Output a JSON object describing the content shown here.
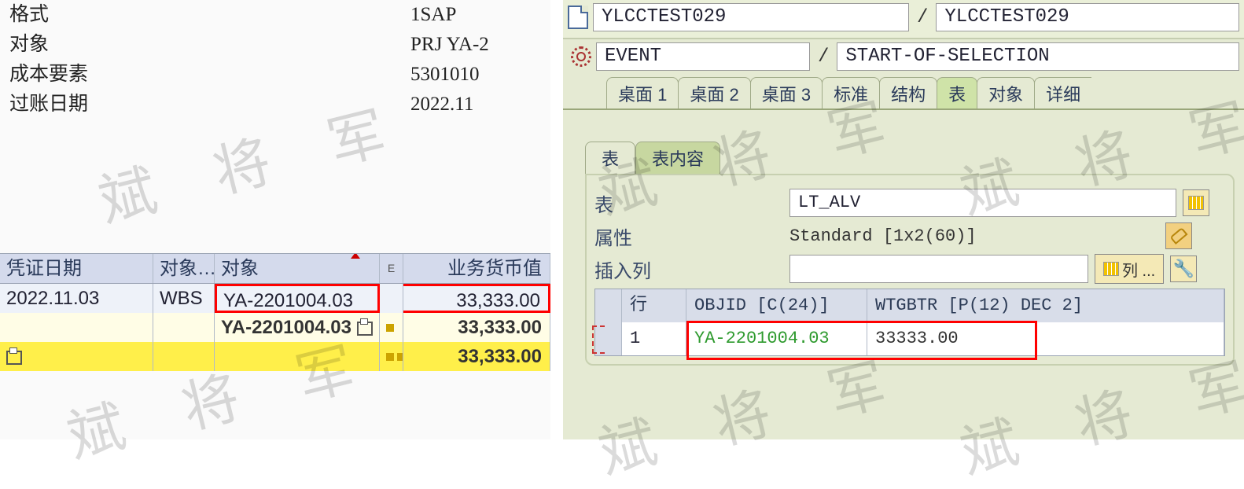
{
  "left": {
    "fields": [
      {
        "label": "格式",
        "value": "1SAP"
      },
      {
        "label": "对象",
        "value": "PRJ YA-2"
      },
      {
        "label": "成本要素",
        "value": "5301010"
      },
      {
        "label": "过账日期",
        "value": "2022.11"
      }
    ],
    "table": {
      "columns": [
        "凭证日期",
        "对象…",
        "对象",
        "E",
        "业务货币值"
      ],
      "rows": [
        {
          "date": "2022.11.03",
          "type": "WBS",
          "obj": "YA-2201004.03",
          "e": "",
          "val": "33,333.00",
          "kind": "data"
        },
        {
          "date": "",
          "type": "",
          "obj": "YA-2201004.03",
          "e": "▪",
          "val": "33,333.00",
          "kind": "sub",
          "icon": true
        },
        {
          "date": "",
          "type": "",
          "obj": "",
          "e": "▪▪",
          "val": "33,333.00",
          "kind": "tot",
          "printer": true
        }
      ]
    }
  },
  "right": {
    "title_left": "YLCCTEST029",
    "title_right": "YLCCTEST029",
    "bc_left": "EVENT",
    "bc_right": "START-OF-SELECTION",
    "desk_tabs": [
      "桌面 1",
      "桌面 2",
      "桌面 3",
      "标准",
      "结构",
      "表",
      "对象",
      "详细"
    ],
    "active_desk_idx": 5,
    "inner_tabs": [
      "表",
      "表内容"
    ],
    "active_inner_idx": 1,
    "props": {
      "table_label": "表",
      "table_value": "LT_ALV",
      "attr_label": "属性",
      "attr_value": "Standard [1x2(60)]",
      "ins_label": "插入列",
      "col_button": "列 ..."
    },
    "alv": {
      "columns": [
        "",
        "行",
        "OBJID [C(24)]",
        "WTGBTR [P(12) DEC 2]"
      ],
      "rows": [
        {
          "n": "1",
          "objid": "YA-2201004.03",
          "wtgbtr": "33333.00"
        }
      ]
    }
  },
  "watermark": "斌 将 军"
}
